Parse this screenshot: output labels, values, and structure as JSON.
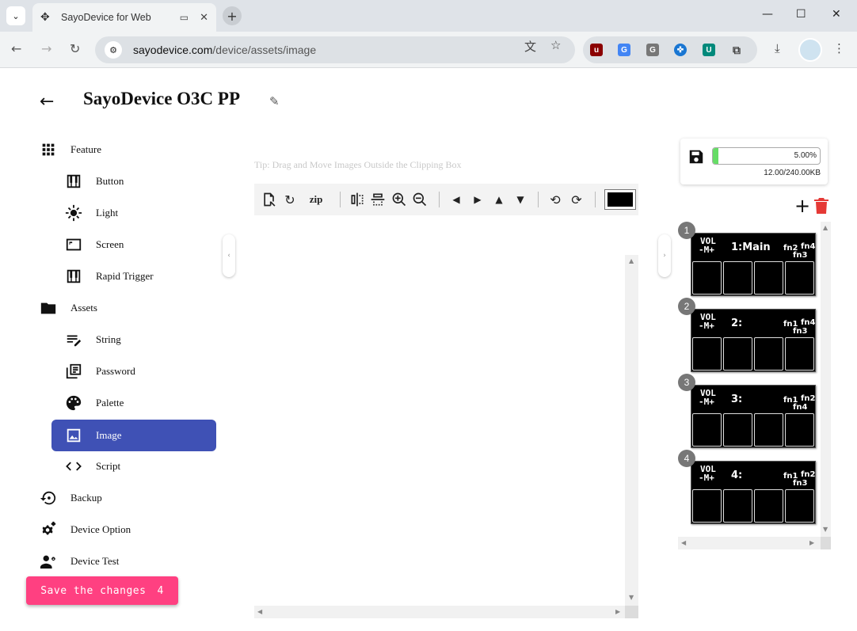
{
  "browser": {
    "tab_title": "SayoDevice for Web",
    "url_host": "sayodevice.com",
    "url_path": "/device/assets/image"
  },
  "header": {
    "title": "SayoDevice O3C PP"
  },
  "sidebar": {
    "items": [
      {
        "label": "Feature",
        "icon": "grid-icon"
      },
      {
        "label": "Button",
        "icon": "piano-keys-icon"
      },
      {
        "label": "Light",
        "icon": "sun-icon"
      },
      {
        "label": "Screen",
        "icon": "screen-icon"
      },
      {
        "label": "Rapid Trigger",
        "icon": "piano-keys-icon"
      },
      {
        "label": "Assets",
        "icon": "folder-icon"
      },
      {
        "label": "String",
        "icon": "text-edit-icon"
      },
      {
        "label": "Password",
        "icon": "library-icon"
      },
      {
        "label": "Palette",
        "icon": "palette-icon"
      },
      {
        "label": "Image",
        "icon": "image-icon",
        "active": true
      },
      {
        "label": "Script",
        "icon": "code-icon"
      },
      {
        "label": "Backup",
        "icon": "restore-icon"
      },
      {
        "label": "Device Option",
        "icon": "gears-icon"
      },
      {
        "label": "Device Test",
        "icon": "engineering-icon"
      }
    ],
    "save_button": {
      "label": "Save the changes",
      "count": "4"
    }
  },
  "editor": {
    "tip": "Tip: Drag and Move Images Outside the Clipping Box",
    "toolbar": {
      "zip_label": "zip"
    },
    "selected_color": "#000000"
  },
  "storage": {
    "percent_label": "5.00%",
    "percent": 5.0,
    "usage": "12.00/240.00KB"
  },
  "images": [
    {
      "index": "1",
      "vol_top": "VOL",
      "vol_bottom": "-M+",
      "label": "1:Main",
      "fn_a": "fn2",
      "fn_b": "fn4",
      "fn_c": "fn3",
      "fn_d": ""
    },
    {
      "index": "2",
      "vol_top": "VOL",
      "vol_bottom": "-M+",
      "label": "2:",
      "fn_a": "fn1",
      "fn_b": "fn4",
      "fn_c": "fn3",
      "fn_d": ""
    },
    {
      "index": "3",
      "vol_top": "VOL",
      "vol_bottom": "-M+",
      "label": "3:",
      "fn_a": "fn1",
      "fn_b": "fn2",
      "fn_c": "fn4",
      "fn_d": ""
    },
    {
      "index": "4",
      "vol_top": "VOL",
      "vol_bottom": "-M+",
      "label": "4:",
      "fn_a": "fn1",
      "fn_b": "fn2",
      "fn_c": "fn3",
      "fn_d": ""
    }
  ]
}
